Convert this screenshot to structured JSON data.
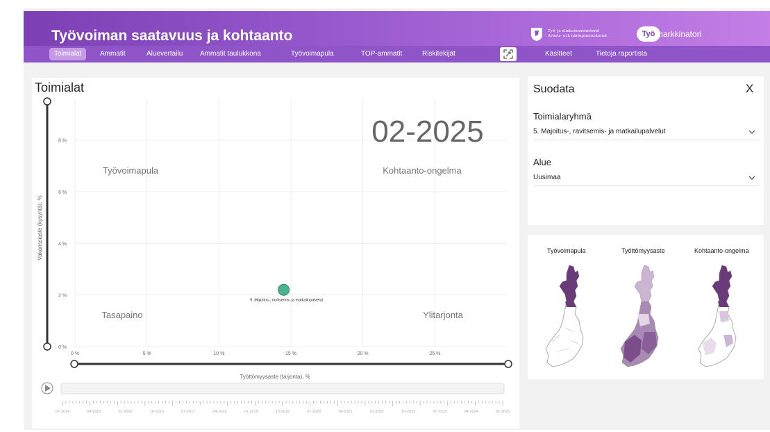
{
  "header": {
    "title": "Työvoiman saatavuus ja kohtaanto",
    "ministry_line1": "Työ- ja elinkeinoministeriö",
    "ministry_line2": "Arbets- och näringsministeriet",
    "logo_circle": "Työ",
    "logo_text": "markkinatori"
  },
  "nav": {
    "tabs": [
      "Toimialat",
      "Ammatit",
      "Aluevertailu",
      "Ammatit taulukkona",
      "Työvoimapula",
      "TOP-ammatit",
      "Riskitekijät"
    ],
    "active": "Toimialat",
    "right_tabs": [
      "Käsitteet",
      "Tietoja raportista"
    ]
  },
  "chart": {
    "card_title": "Toimialat",
    "date_label": "02-2025",
    "quadrants": {
      "top_left": "Työvoimapula",
      "top_right": "Kohtaanto-ongelma",
      "bottom_left": "Tasapaino",
      "bottom_right": "Ylitarjonta"
    },
    "timeline": {
      "ticks": [
        "07-2014",
        "04-2015",
        "01-2016",
        "10-2016",
        "07-2017",
        "04-2018",
        "01-2019",
        "10-2019",
        "07-2020",
        "04-2021",
        "01-2022",
        "10-2022",
        "07-2023",
        "04-2024",
        "01-2025"
      ]
    }
  },
  "chart_data": {
    "type": "scatter",
    "title": "Toimialat",
    "xlabel": "Työttömyysaste (tarjonta), %",
    "ylabel": "Vakanssiaste (kysyntä), %",
    "xlim": [
      0,
      30
    ],
    "ylim": [
      0,
      9.5
    ],
    "x_ticks": [
      "0 %",
      "5 %",
      "10 %",
      "15 %",
      "20 %",
      "25 %"
    ],
    "y_ticks": [
      "0 %",
      "2 %",
      "4 %",
      "6 %",
      "8 %"
    ],
    "points": [
      {
        "label": "5. Majoitus-, ravitsemis- ja matkailupalvelut",
        "x": 14.5,
        "y": 2.2,
        "color": "#4db38e"
      }
    ]
  },
  "filter": {
    "title": "Suodata",
    "close": "X",
    "group_label": "Toimialaryhmä",
    "group_value": "5. Majoitus-, ravitsemis- ja matkailupalvelut",
    "area_label": "Alue",
    "area_value": "Uusimaa"
  },
  "maps": {
    "labels": [
      "Työvoimapula",
      "Työttömyysaste",
      "Kohtaanto-ongelma"
    ],
    "accent": "#6b3a78"
  },
  "colors": {
    "header_start": "#7c3fb4",
    "header_end": "#c47ee6",
    "nav": "#8f55c8",
    "point": "#4db38e"
  }
}
